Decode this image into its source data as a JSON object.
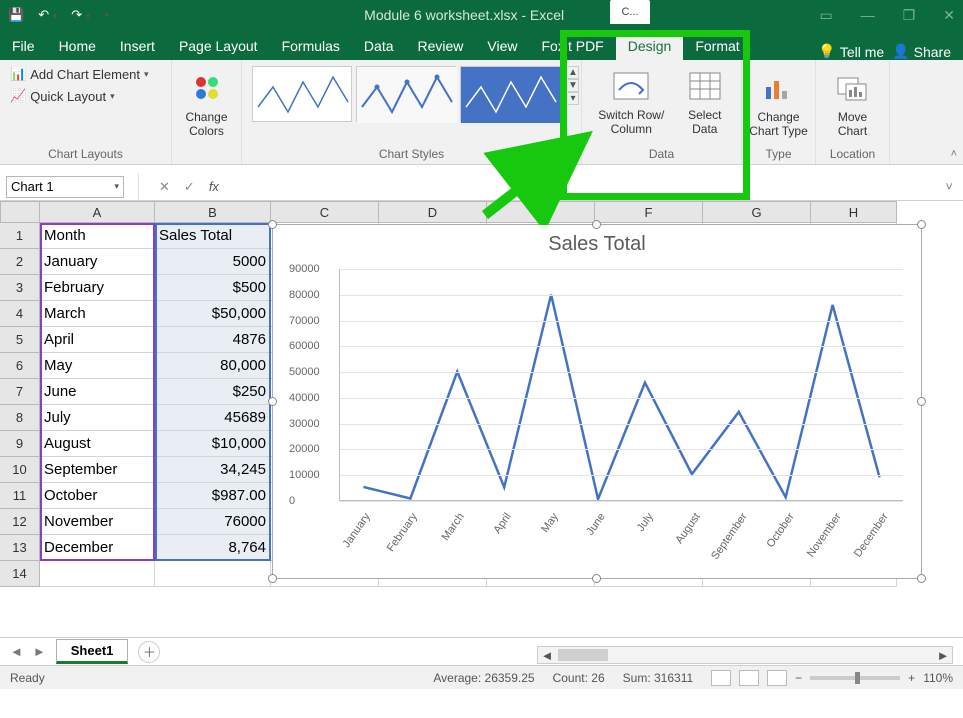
{
  "title": {
    "doc": "Module 6 worksheet.xlsx  -  Excel",
    "context_tab": "C..."
  },
  "qat": {
    "save": "save",
    "undo": "undo",
    "redo": "redo"
  },
  "win": {
    "ro": "▭",
    "min": "—",
    "max": "❐",
    "close": "✕"
  },
  "tabs": [
    "File",
    "Home",
    "Insert",
    "Page Layout",
    "Formulas",
    "Data",
    "Review",
    "View",
    "Foxit PDF",
    "Design",
    "Format"
  ],
  "tabs_right": {
    "tell": "Tell me",
    "share": "Share"
  },
  "ribbon": {
    "chart_layouts": {
      "add": "Add Chart Element",
      "quick": "Quick Layout",
      "label": "Chart Layouts"
    },
    "colors": {
      "btn": "Change\nColors",
      "label": ""
    },
    "styles": {
      "label": "Chart Styles"
    },
    "data": {
      "switch": "Switch Row/\nColumn",
      "select": "Select\nData",
      "label": "Data"
    },
    "type": {
      "btn": "Change\nChart Type",
      "label": "Type"
    },
    "location": {
      "btn": "Move\nChart",
      "label": "Location"
    }
  },
  "namebox": "Chart 1",
  "fx": {
    "cancel": "✕",
    "ok": "✓",
    "fx": "fx"
  },
  "columns": [
    "A",
    "B",
    "C",
    "D",
    "E",
    "F",
    "G",
    "H"
  ],
  "rows": [
    "1",
    "2",
    "3",
    "4",
    "5",
    "6",
    "7",
    "8",
    "9",
    "10",
    "11",
    "12",
    "13",
    "14"
  ],
  "table": {
    "header": {
      "month": "Month",
      "sales": "Sales Total"
    },
    "rows": [
      {
        "m": "January",
        "s": "5000"
      },
      {
        "m": "February",
        "s": "$500"
      },
      {
        "m": "March",
        "s": "$50,000"
      },
      {
        "m": "April",
        "s": "4876"
      },
      {
        "m": "May",
        "s": "80,000"
      },
      {
        "m": "June",
        "s": "$250"
      },
      {
        "m": "July",
        "s": "45689"
      },
      {
        "m": "August",
        "s": "$10,000"
      },
      {
        "m": "September",
        "s": "34,245"
      },
      {
        "m": "October",
        "s": "$987.00"
      },
      {
        "m": "November",
        "s": "76000"
      },
      {
        "m": "December",
        "s": "8,764"
      }
    ]
  },
  "chart_data": {
    "type": "line",
    "title": "Sales Total",
    "categories": [
      "January",
      "February",
      "March",
      "April",
      "May",
      "June",
      "July",
      "August",
      "September",
      "October",
      "November",
      "December"
    ],
    "values": [
      5000,
      500,
      50000,
      4876,
      80000,
      250,
      45689,
      10000,
      34245,
      987,
      76000,
      8764
    ],
    "ylim": [
      0,
      90000
    ],
    "ytick": 10000,
    "xlabel": "",
    "ylabel": ""
  },
  "sheet_tabs": {
    "active": "Sheet1"
  },
  "status": {
    "ready": "Ready",
    "avg_l": "Average:",
    "avg_v": "26359.25",
    "cnt_l": "Count:",
    "cnt_v": "26",
    "sum_l": "Sum:",
    "sum_v": "316311",
    "zoom": "110%"
  }
}
